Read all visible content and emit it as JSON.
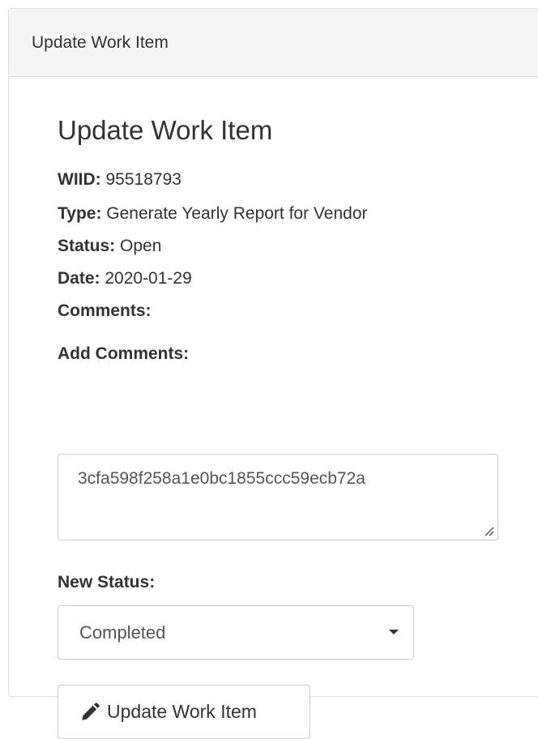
{
  "panel": {
    "heading": "Update Work Item"
  },
  "form": {
    "title": "Update Work Item",
    "wiid_label": "WIID:",
    "wiid_value": " 95518793",
    "type_label": "Type:",
    "type_value": " Generate Yearly Report for Vendor",
    "status_label": "Status:",
    "status_value": " Open",
    "date_label": "Date:",
    "date_value": " 2020-01-29",
    "comments_label": "Comments:",
    "add_comments_label": "Add Comments:",
    "add_comments_value": "3cfa598f258a1e0bc1855ccc59ecb72a",
    "new_status_label": "New Status:",
    "new_status_selected": "Completed",
    "submit_label": "Update Work Item"
  },
  "icons": {
    "submit_icon": "pencil-icon",
    "select_caret": "caret-down-icon",
    "resize": "resize-handle-icon"
  }
}
